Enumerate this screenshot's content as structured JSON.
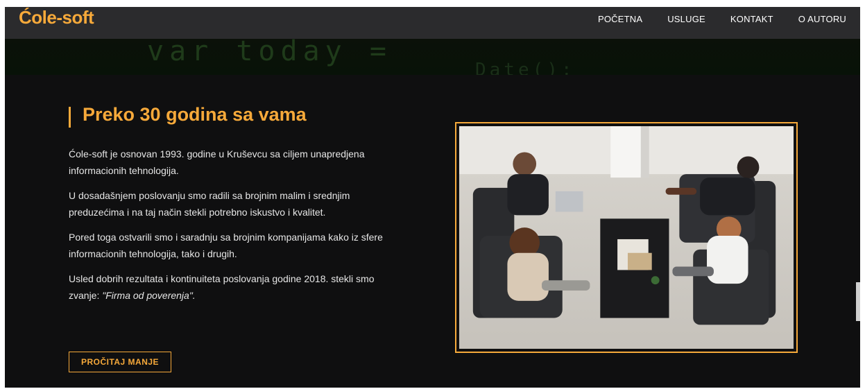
{
  "header": {
    "brand": "Ćole-soft",
    "nav": [
      "POČETNA",
      "USLUGE",
      "KONTAKT",
      "O AUTORU"
    ]
  },
  "banner": {
    "code_top": "var today =",
    "code_bottom": "Date();"
  },
  "main": {
    "title": "Preko 30 godina sa vama",
    "paragraphs": [
      "Ćole-soft je osnovan 1993. godine u Kruševcu sa ciljem unapredjena informacionih tehnologija.",
      "U dosadašnjem poslovanju smo radili sa brojnim malim i srednjim preduzećima i na taj način stekli potrebno iskustvo i kvalitet.",
      "Pored toga ostvarili smo i saradnju sa brojnim kompanijama kako iz sfere informacionih tehnologija, tako i drugih."
    ],
    "last_paragraph_prefix": "Usled dobrih rezultata i kontinuiteta poslovanja godine 2018. stekli smo zvanje: ",
    "last_paragraph_emphasis": "\"Firma od poverenja\".",
    "button": "PROČITAJ MANJE"
  },
  "colors": {
    "accent": "#f6a93a",
    "background": "#0f0f10",
    "header": "#2b2b2d"
  }
}
